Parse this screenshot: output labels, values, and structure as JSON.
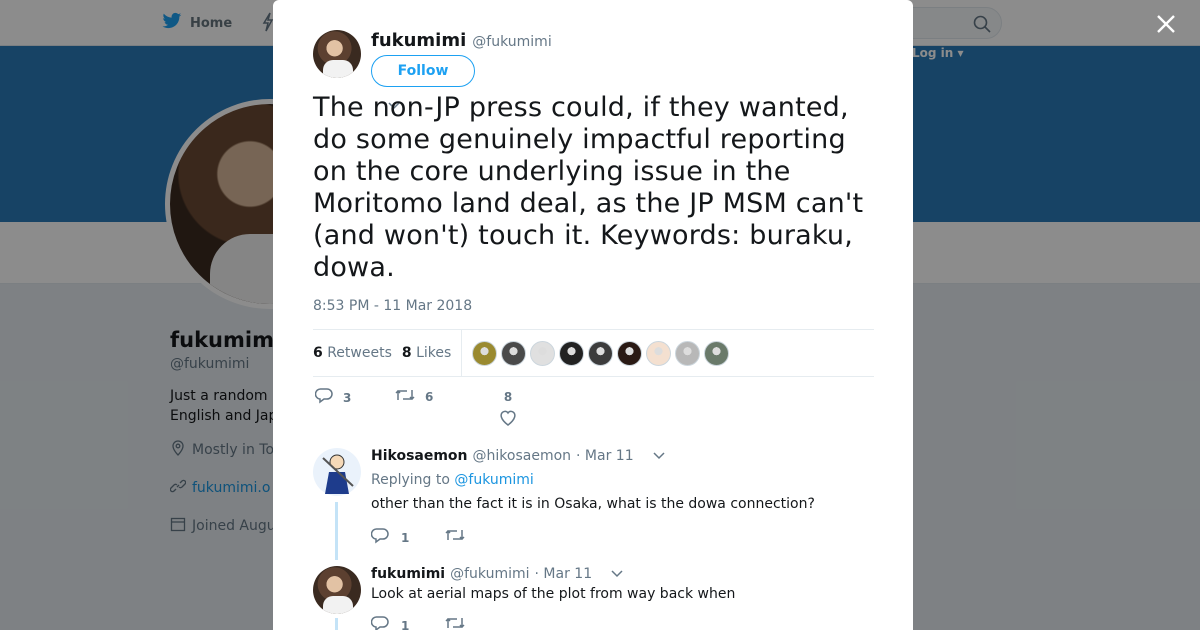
{
  "bg": {
    "home_label": "Home",
    "login_label": "Log in",
    "profile_name": "fukumimi",
    "profile_handle": "@fukumimi",
    "bio_line1": "Just a random",
    "bio_line2": "English and Jap",
    "location": "Mostly in To",
    "website": "fukumimi.o",
    "joined": "Joined Augu"
  },
  "tweet": {
    "fullname": "fukumimi",
    "handle": "@fukumimi",
    "follow_label": "Follow",
    "text": "The non-JP press could, if they wanted, do some genuinely impactful reporting on the core underlying issue in the Moritomo land deal, as the JP MSM can't (and won't) touch it. Keywords: buraku, dowa.",
    "timestamp": "8:53 PM - 11 Mar 2018",
    "retweets_count": "6",
    "retweets_label": "Retweets",
    "likes_count": "8",
    "likes_label": "Likes",
    "action_reply_count": "3",
    "action_retweet_count": "6",
    "action_like_count": "8"
  },
  "likers": [
    "#9a8a30",
    "#4a4a4a",
    "#e0e0e0",
    "#222222",
    "#3c3c3c",
    "#2a1a14",
    "#f4e0d0",
    "#b8b8b8",
    "#6a7a6a"
  ],
  "replies": [
    {
      "fullname": "Hikosaemon",
      "handle": "@hikosaemon",
      "time": "· Mar 11",
      "replying_label": "Replying to",
      "replying_to": "@fukumimi",
      "text": "other than the fact it is in Osaka, what is the dowa connection?",
      "reply_count": "1"
    },
    {
      "fullname": "fukumimi",
      "handle": "@fukumimi",
      "time": "· Mar 11",
      "text": "Look at aerial maps of the plot from way back when",
      "reply_count": "1"
    }
  ],
  "colors": {
    "brand": "#1da1f2",
    "cover": "#2b7bb9",
    "overlay": "rgba(0,0,0,0.45)"
  },
  "icons": [
    "twitter-bird-icon",
    "search-icon",
    "close-icon",
    "reply-icon",
    "retweet-icon",
    "heart-icon",
    "chevron-down-icon",
    "location-icon",
    "link-icon",
    "calendar-icon"
  ]
}
